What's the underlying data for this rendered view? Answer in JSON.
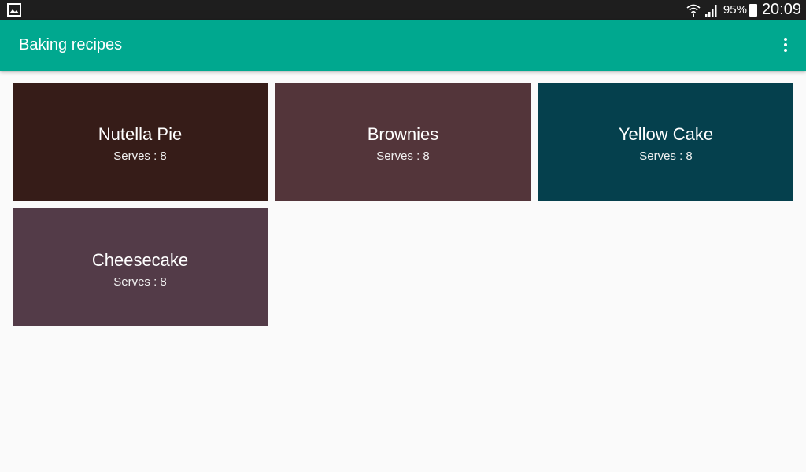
{
  "status_bar": {
    "battery": "95%",
    "time": "20:09",
    "left_icon": "gallery-icon",
    "wifi_icon": "wifi-icon",
    "signal_icon": "signal-icon",
    "battery_icon": "battery-icon"
  },
  "app_bar": {
    "title": "Baking recipes",
    "overflow_icon": "more-vert-icon",
    "color": "#00a88f"
  },
  "recipes": [
    {
      "name": "Nutella Pie",
      "serves": "Serves : 8",
      "color": "#361c18"
    },
    {
      "name": "Brownies",
      "serves": "Serves : 8",
      "color": "#53353a"
    },
    {
      "name": "Yellow Cake",
      "serves": "Serves : 8",
      "color": "#05404d"
    },
    {
      "name": "Cheesecake",
      "serves": "Serves : 8",
      "color": "#533b48"
    }
  ]
}
